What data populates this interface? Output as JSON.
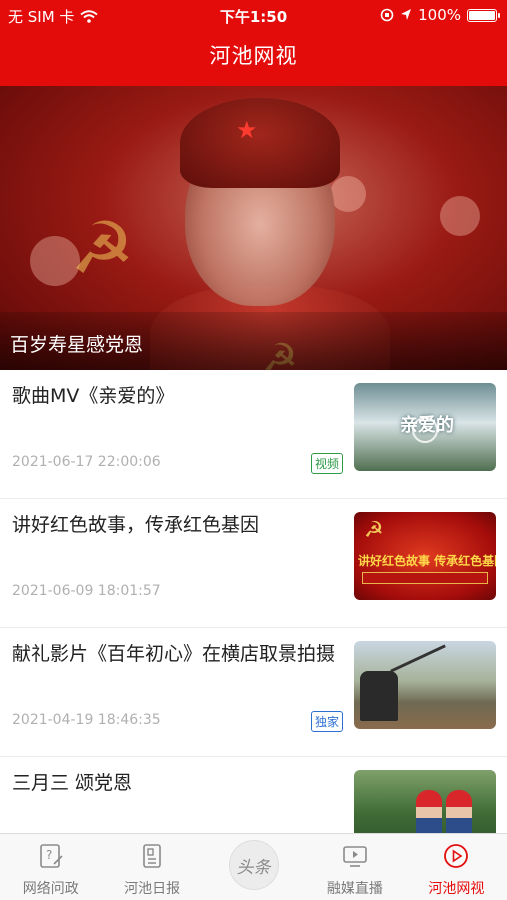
{
  "status_bar": {
    "carrier": "无 SIM 卡",
    "time": "下午1:50",
    "battery_percent": "100%",
    "battery_level": 1.0
  },
  "nav": {
    "title": "河池网视"
  },
  "hero": {
    "caption": "百岁寿星感党恩"
  },
  "news": [
    {
      "title": "歌曲MV《亲爱的》",
      "date": "2021-06-17 22:00:06",
      "tag": "视频",
      "tag_color": "#2e9a46",
      "thumb_text": "亲爱的"
    },
    {
      "title": "讲好红色故事，传承红色基因",
      "date": "2021-06-09 18:01:57",
      "tag": "",
      "thumb_text": "讲好红色故事 传承红色基因"
    },
    {
      "title": "献礼影片《百年初心》在横店取景拍摄",
      "date": "2021-04-19 18:46:35",
      "tag": "独家",
      "tag_color": "#2b6fd1",
      "thumb_text": ""
    },
    {
      "title": "三月三 颂党恩",
      "date": "",
      "tag": "",
      "thumb_text": ""
    }
  ],
  "tabs": [
    {
      "label": "网络问政",
      "icon": "question-doc-icon"
    },
    {
      "label": "河池日报",
      "icon": "newspaper-icon"
    },
    {
      "label": "头条",
      "icon": "headline-logo-icon"
    },
    {
      "label": "融媒直播",
      "icon": "tv-icon"
    },
    {
      "label": "河池网视",
      "icon": "play-circle-icon"
    }
  ],
  "colors": {
    "brand_red": "#e40b0b",
    "tag_green": "#2e9a46",
    "tag_blue": "#2b6fd1"
  }
}
